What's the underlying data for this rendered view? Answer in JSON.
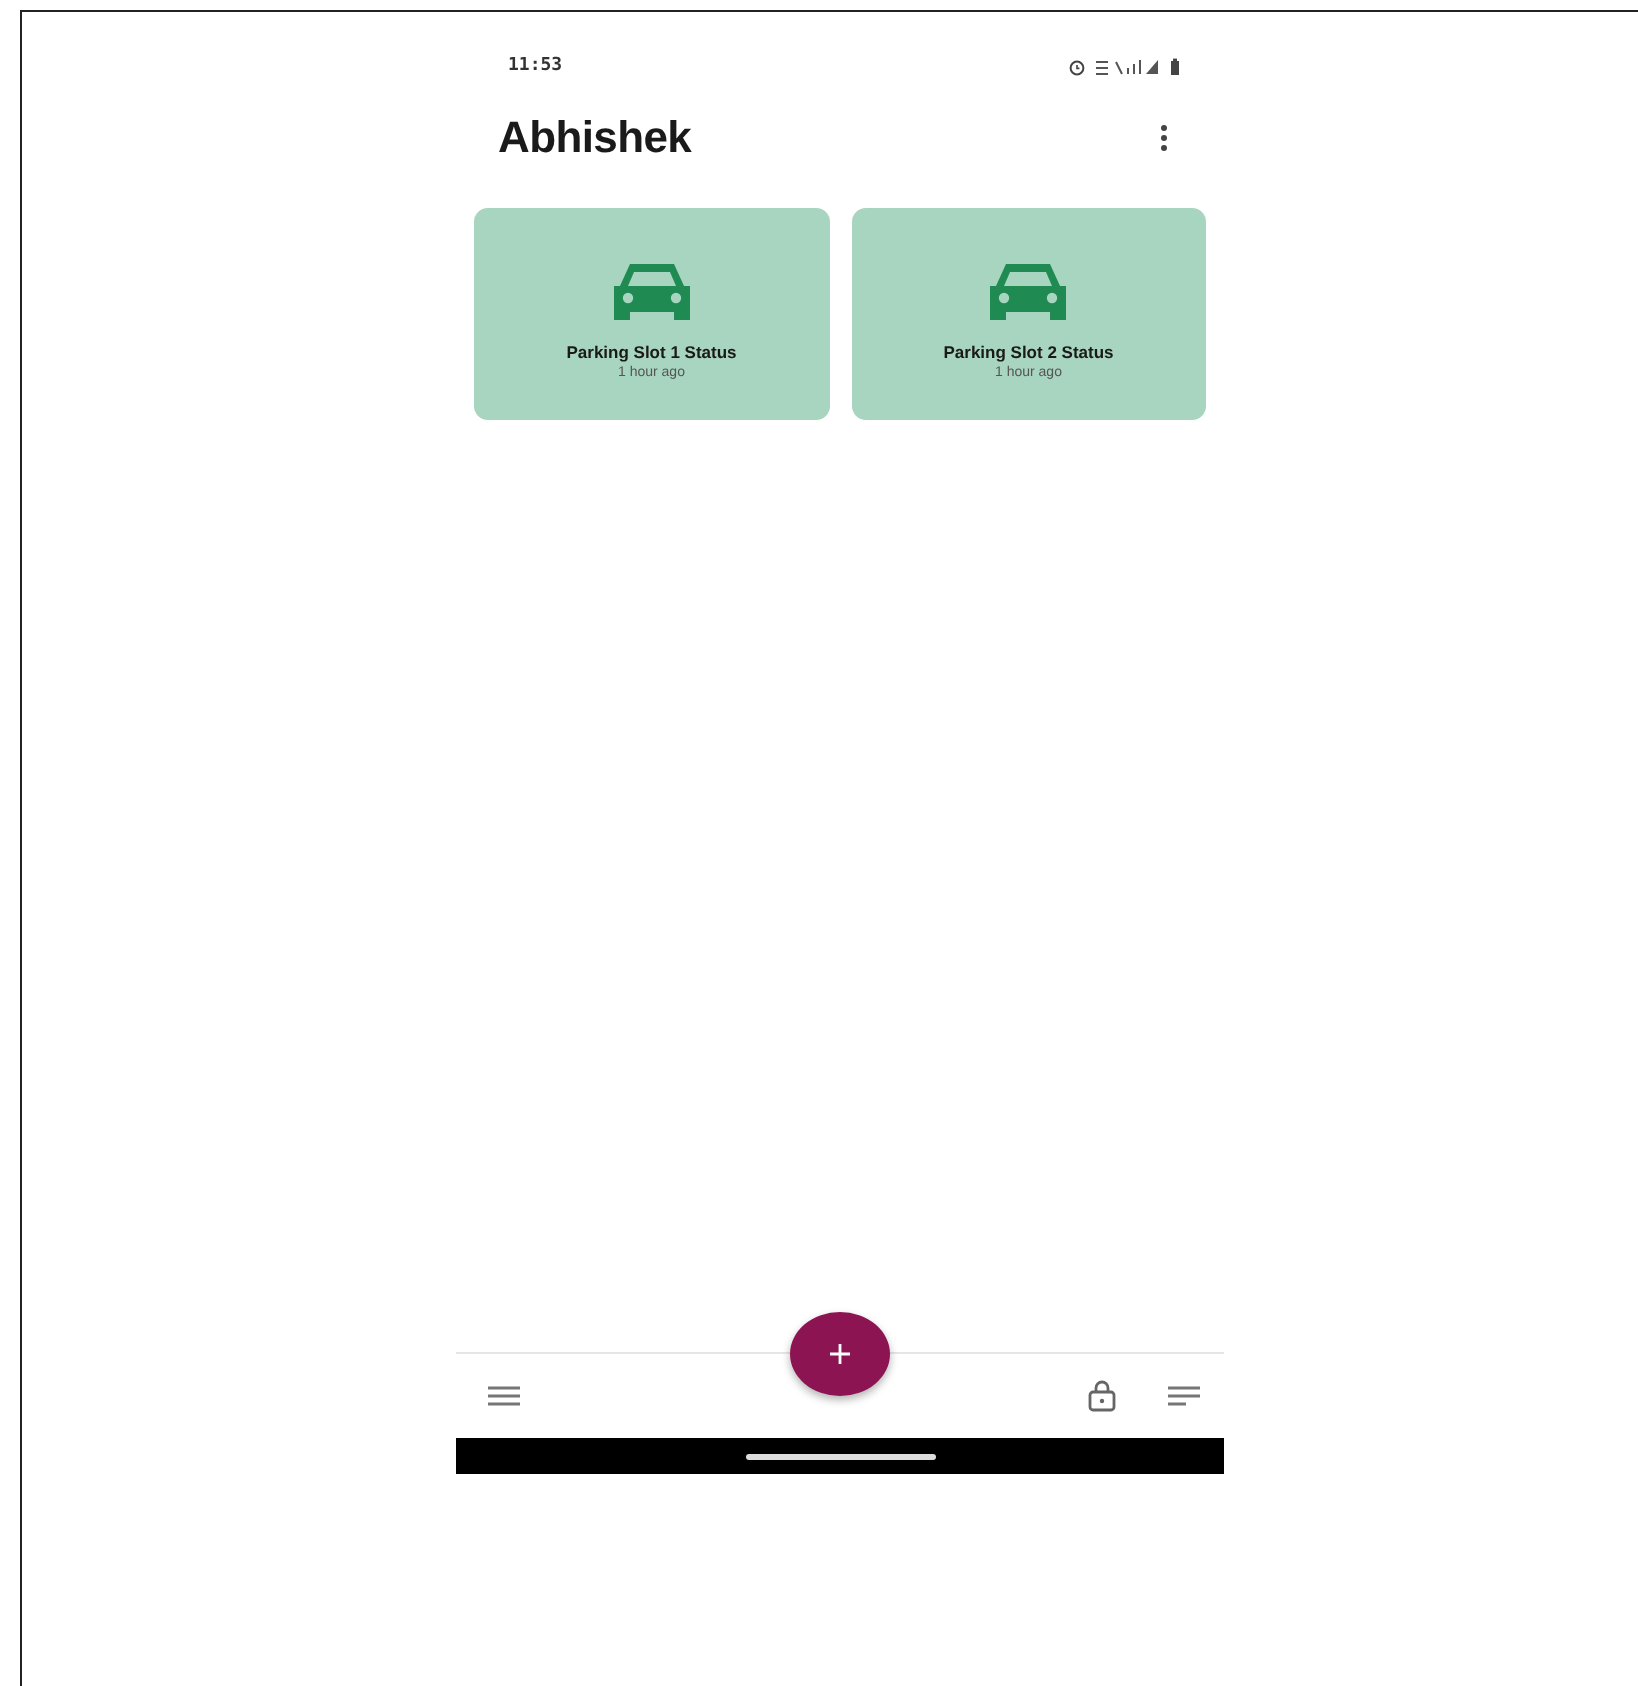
{
  "status_bar": {
    "time": "11:53"
  },
  "header": {
    "title": "Abhishek"
  },
  "cards": [
    {
      "title": "Parking Slot 1 Status",
      "subtitle": "1 hour ago"
    },
    {
      "title": "Parking Slot 2 Status",
      "subtitle": "1 hour ago"
    }
  ]
}
